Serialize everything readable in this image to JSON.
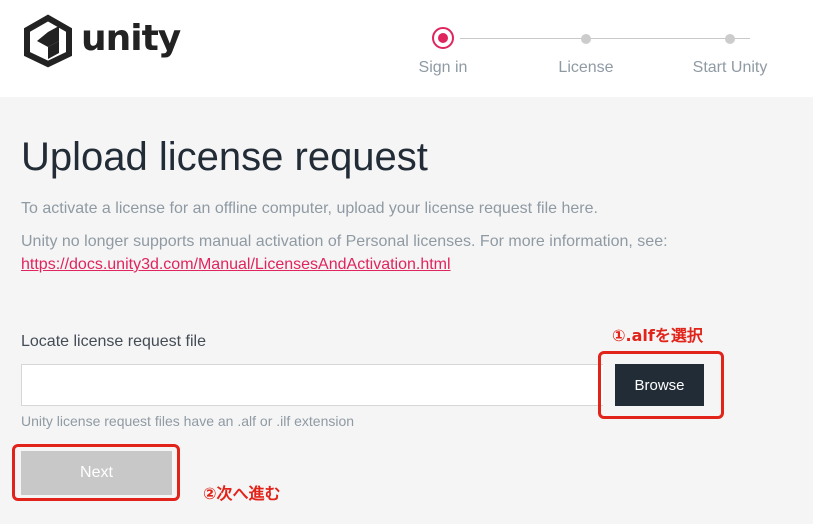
{
  "brand": {
    "logo_text": "unity"
  },
  "steps": [
    {
      "label": "Sign in",
      "state": "active"
    },
    {
      "label": "License",
      "state": "pending"
    },
    {
      "label": "Start Unity",
      "state": "pending"
    }
  ],
  "main": {
    "title": "Upload license request",
    "description_1": "To activate a license for an offline computer, upload your license request file here.",
    "description_2": "Unity no longer supports manual activation of Personal licenses. For more information, see:",
    "doc_link": "https://docs.unity3d.com/Manual/LicensesAndActivation.html",
    "file_field": {
      "label": "Locate license request file",
      "value": "",
      "browse_label": "Browse",
      "hint": "Unity license request files have an .alf or .ilf extension"
    },
    "next_label": "Next"
  },
  "annotations": {
    "browse_note": "①.alfを選択",
    "next_note": "②次へ進む"
  },
  "colors": {
    "accent": "#e0245e",
    "dark_button": "#222c37",
    "disabled_button": "#c8c8c8",
    "annotation_red": "#e2231a"
  }
}
